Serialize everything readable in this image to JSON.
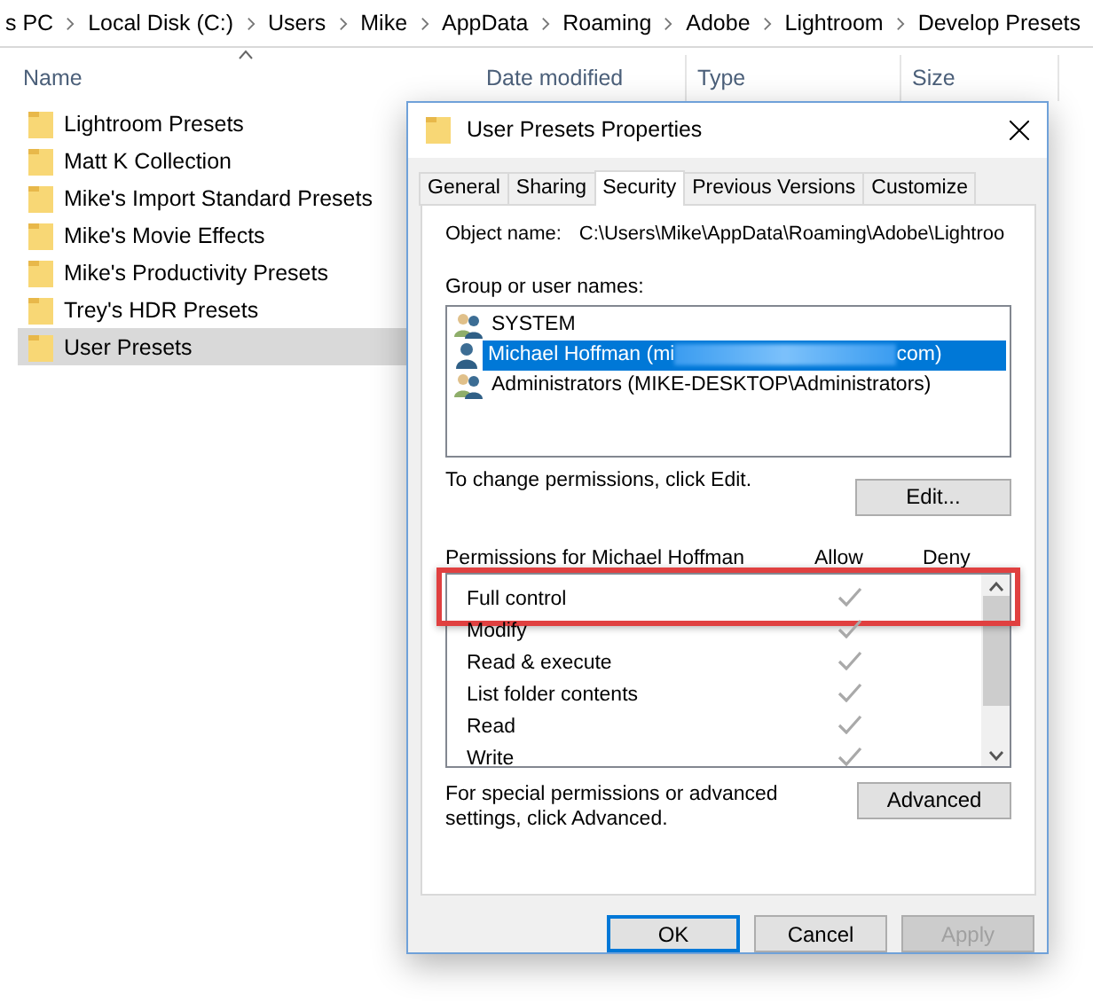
{
  "breadcrumb": [
    "s PC",
    "Local Disk (C:)",
    "Users",
    "Mike",
    "AppData",
    "Roaming",
    "Adobe",
    "Lightroom",
    "Develop Presets"
  ],
  "columns": [
    {
      "label": "Name",
      "sorted": true
    },
    {
      "label": "Date modified",
      "sorted": false
    },
    {
      "label": "Type",
      "sorted": false
    },
    {
      "label": "Size",
      "sorted": false
    }
  ],
  "files": [
    {
      "name": "Lightroom Presets",
      "selected": false
    },
    {
      "name": "Matt K Collection",
      "selected": false
    },
    {
      "name": "Mike's Import Standard Presets",
      "selected": false
    },
    {
      "name": "Mike's Movie Effects",
      "selected": false
    },
    {
      "name": "Mike's Productivity Presets",
      "selected": false
    },
    {
      "name": "Trey's HDR Presets",
      "selected": false
    },
    {
      "name": "User Presets",
      "selected": true
    }
  ],
  "dialog": {
    "title": "User Presets Properties",
    "tabs": [
      {
        "label": "General",
        "selected": false
      },
      {
        "label": "Sharing",
        "selected": false
      },
      {
        "label": "Security",
        "selected": true
      },
      {
        "label": "Previous Versions",
        "selected": false
      },
      {
        "label": "Customize",
        "selected": false
      }
    ],
    "object_name_label": "Object name:",
    "object_name": "C:\\Users\\Mike\\AppData\\Roaming\\Adobe\\Lightroo",
    "group_label": "Group or user names:",
    "users": [
      {
        "name": "SYSTEM",
        "kind": "group",
        "selected": false,
        "redacted": false
      },
      {
        "name": "Michael Hoffman (mi",
        "name_end": "com)",
        "kind": "user",
        "selected": true,
        "redacted": true
      },
      {
        "name": "Administrators (MIKE-DESKTOP\\Administrators)",
        "kind": "group",
        "selected": false,
        "redacted": false
      }
    ],
    "change_text": "To change permissions, click Edit.",
    "edit_button": "Edit...",
    "permissions_label": "Permissions for Michael Hoffman",
    "allow_label": "Allow",
    "deny_label": "Deny",
    "permissions": [
      {
        "name": "Full control",
        "allow": true,
        "deny": false,
        "highlighted": true
      },
      {
        "name": "Modify",
        "allow": true,
        "deny": false,
        "highlighted": false
      },
      {
        "name": "Read & execute",
        "allow": true,
        "deny": false,
        "highlighted": false
      },
      {
        "name": "List folder contents",
        "allow": true,
        "deny": false,
        "highlighted": false
      },
      {
        "name": "Read",
        "allow": true,
        "deny": false,
        "highlighted": false
      },
      {
        "name": "Write",
        "allow": true,
        "deny": false,
        "highlighted": false
      }
    ],
    "advanced_text": "For special permissions or advanced settings, click Advanced.",
    "advanced_button": "Advanced",
    "buttons": [
      {
        "label": "OK",
        "default": true,
        "disabled": false
      },
      {
        "label": "Cancel",
        "default": false,
        "disabled": false
      },
      {
        "label": "Apply",
        "default": false,
        "disabled": true
      }
    ]
  }
}
